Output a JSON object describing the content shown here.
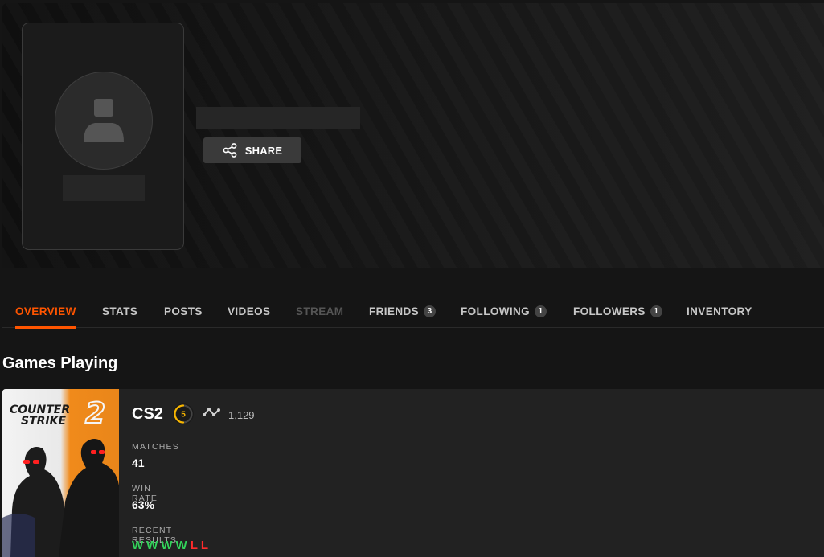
{
  "profile": {
    "share_label": "SHARE"
  },
  "tabs": [
    {
      "label": "OVERVIEW",
      "badge": null
    },
    {
      "label": "STATS",
      "badge": null
    },
    {
      "label": "POSTS",
      "badge": null
    },
    {
      "label": "VIDEOS",
      "badge": null
    },
    {
      "label": "STREAM",
      "badge": null
    },
    {
      "label": "FRIENDS",
      "badge": "3"
    },
    {
      "label": "FOLLOWING",
      "badge": "1"
    },
    {
      "label": "FOLLOWERS",
      "badge": "1"
    },
    {
      "label": "INVENTORY",
      "badge": null
    }
  ],
  "active_tab": "OVERVIEW",
  "section": {
    "title": "Games Playing"
  },
  "game": {
    "cover_title_line1": "COUNTER",
    "cover_title_line2": "STRIKE",
    "cover_title_number": "2",
    "name": "CS2",
    "level": "5",
    "level_fraction": 0.5,
    "elo": "1,129",
    "stats": {
      "matches_label": "MATCHES",
      "matches_value": "41",
      "winrate_label": "WIN RATE",
      "winrate_value": "63%",
      "recent_label": "RECENT RESULTS"
    },
    "recent_results": [
      "W",
      "W",
      "W",
      "W",
      "L",
      "L"
    ]
  },
  "colors": {
    "accent": "#ff5500",
    "win": "#32d35a",
    "loss": "#ff2b2b",
    "level": "#f7b500"
  },
  "icons": {
    "share": "share-icon",
    "avatar": "user-silhouette-icon",
    "elo": "elo-wave-icon",
    "level": "skill-level-icon"
  }
}
